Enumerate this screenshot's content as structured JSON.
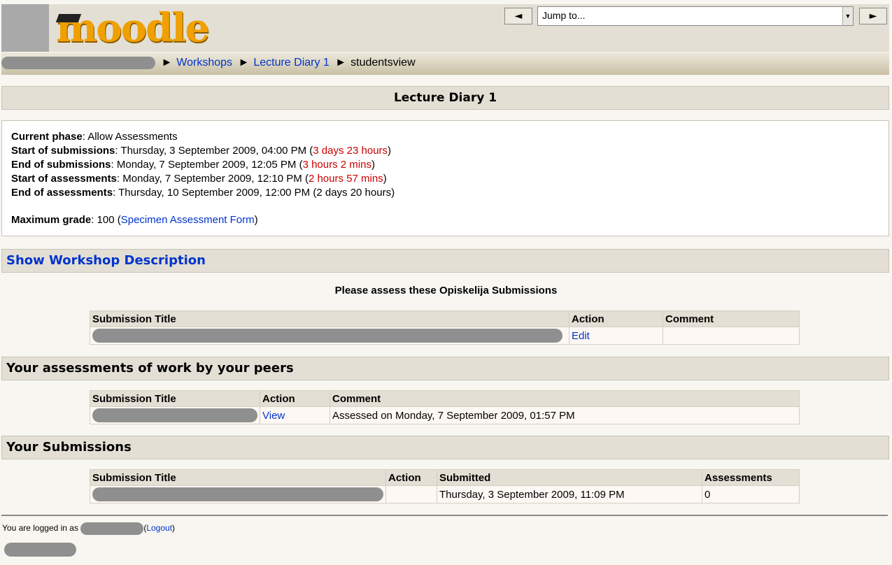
{
  "header": {
    "logo_text": "moodle",
    "prev_label": "◄",
    "next_label": "►",
    "jump_placeholder": "Jump to..."
  },
  "breadcrumb": {
    "items": [
      "Workshops",
      "Lecture Diary 1",
      "studentsview"
    ],
    "separator": "►"
  },
  "page_title": "Lecture Diary 1",
  "info": {
    "current_phase_label": "Current phase",
    "current_phase": ": Allow Assessments",
    "start_sub_label": "Start of submissions",
    "start_sub": ": Thursday, 3 September 2009, 04:00 PM (",
    "start_sub_delta": "3 days 23 hours",
    "end_sub_label": "End of submissions",
    "end_sub": ": Monday, 7 September 2009, 12:05 PM (",
    "end_sub_delta": "3 hours 2 mins",
    "start_ass_label": "Start of assessments",
    "start_ass": ": Monday, 7 September 2009, 12:10 PM (",
    "start_ass_delta": "2 hours 57 mins",
    "end_ass_label": "End of assessments",
    "end_ass": ": Thursday, 10 September 2009, 12:00 PM (2 days 20 hours)",
    "close_paren": ")",
    "max_grade_label": "Maximum grade",
    "max_grade": ": 100 (",
    "specimen_link": "Specimen Assessment Form"
  },
  "workshop_description_link": "Show Workshop Description",
  "assess_heading": "Please assess these Opiskelija Submissions",
  "assess_table": {
    "headers": [
      "Submission Title",
      "Action",
      "Comment"
    ],
    "rows": [
      {
        "action": "Edit",
        "comment": ""
      }
    ]
  },
  "peers_heading": "Your assessments of work by your peers",
  "peers_table": {
    "headers": [
      "Submission Title",
      "Action",
      "Comment"
    ],
    "rows": [
      {
        "action": "View",
        "comment": "Assessed on Monday, 7 September 2009, 01:57 PM"
      }
    ]
  },
  "subs_heading": "Your Submissions",
  "subs_table": {
    "headers": [
      "Submission Title",
      "Action",
      "Submitted",
      "Assessments"
    ],
    "rows": [
      {
        "action": "",
        "submitted": "Thursday, 3 September 2009, 11:09 PM",
        "assessments": "0"
      }
    ]
  },
  "footer": {
    "logged_in_as": "You are logged in as",
    "logout_open": "(",
    "logout_link": "Logout",
    "logout_close": ")"
  },
  "colors": {
    "link": "#0033cc",
    "deadline": "#cc0000",
    "header_bg": "#e3dfd4",
    "redaction": "#8f8f8f"
  }
}
